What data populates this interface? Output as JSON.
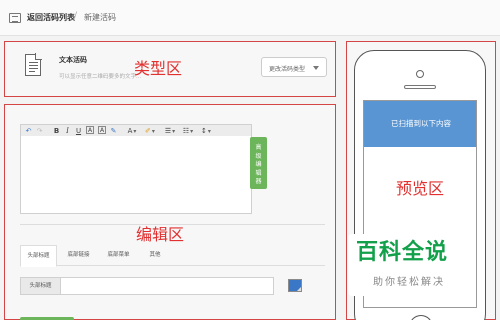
{
  "topbar": {
    "back_label": "返回活码列表",
    "separator": "/",
    "current": "新建活码"
  },
  "type_section": {
    "title": "文本活码",
    "description": "可以显示任意二维码要多的文字...",
    "change_button": "更改活码类型",
    "annotation": "类型区"
  },
  "editor": {
    "toolbar": {
      "undo": "↶",
      "redo": "↷",
      "bold": "B",
      "italic": "I",
      "underline": "U",
      "strike": "A",
      "box": "A",
      "marker": "✎",
      "font_color": "A",
      "highlight": "✐",
      "list": "☰",
      "align": "☷",
      "line_height": "↕"
    },
    "advanced_button": [
      "高",
      "级",
      "编",
      "辑",
      "器"
    ],
    "annotation": "编辑区",
    "tabs": [
      {
        "label": "头部标题"
      },
      {
        "label": "底部链接"
      },
      {
        "label": "底部菜单"
      },
      {
        "label": "其他"
      }
    ],
    "field_label": "头部标题",
    "field_value": "",
    "accent_color": "#3a78c7"
  },
  "preview": {
    "header_text": "已扫描到以下内容",
    "annotation": "预览区"
  },
  "watermark": {
    "title": "百科全说",
    "subtitle": "助你轻松解决"
  }
}
